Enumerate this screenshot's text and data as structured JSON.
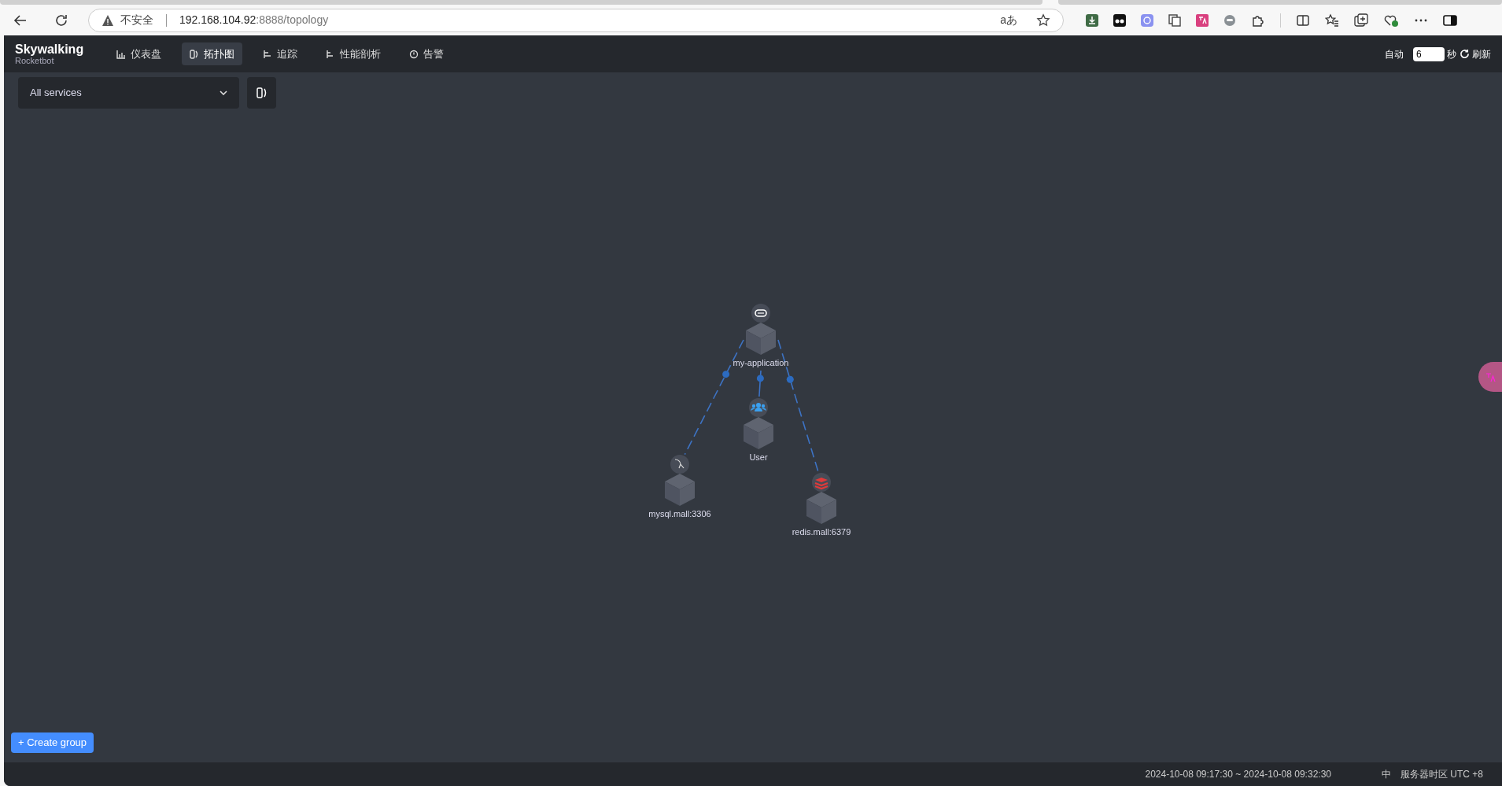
{
  "browser": {
    "security": "不安全",
    "url_host": "192.168.104.92",
    "url_rest": ":8888/topology",
    "translate_glyph": "aあ"
  },
  "app": {
    "logo": "Skywalking",
    "logo_sub": "Rocketbot",
    "nav": [
      {
        "label": "仪表盘",
        "kind": "dashboard",
        "selected": false
      },
      {
        "label": "拓扑图",
        "kind": "topology",
        "selected": true
      },
      {
        "label": "追踪",
        "kind": "trace",
        "selected": false
      },
      {
        "label": "性能剖析",
        "kind": "profile",
        "selected": false
      },
      {
        "label": "告警",
        "kind": "alarm",
        "selected": false
      }
    ],
    "refresh": {
      "auto_label": "自动",
      "interval": "6",
      "unit": "秒",
      "refresh_label": "刷新"
    },
    "service_select": {
      "value": "All services"
    },
    "topology": {
      "nodes": [
        {
          "name": "my-application",
          "kind": "service"
        },
        {
          "name": "User",
          "kind": "user"
        },
        {
          "name": "mysql.mall:3306",
          "kind": "mysql"
        },
        {
          "name": "redis.mall:6379",
          "kind": "redis"
        }
      ]
    },
    "create_group": "+ Create group",
    "footer": {
      "time_range": "2024-10-08 09:17:30 ~ 2024-10-08 09:32:30",
      "language": "中",
      "timezone": "服务器时区 UTC +8"
    }
  }
}
